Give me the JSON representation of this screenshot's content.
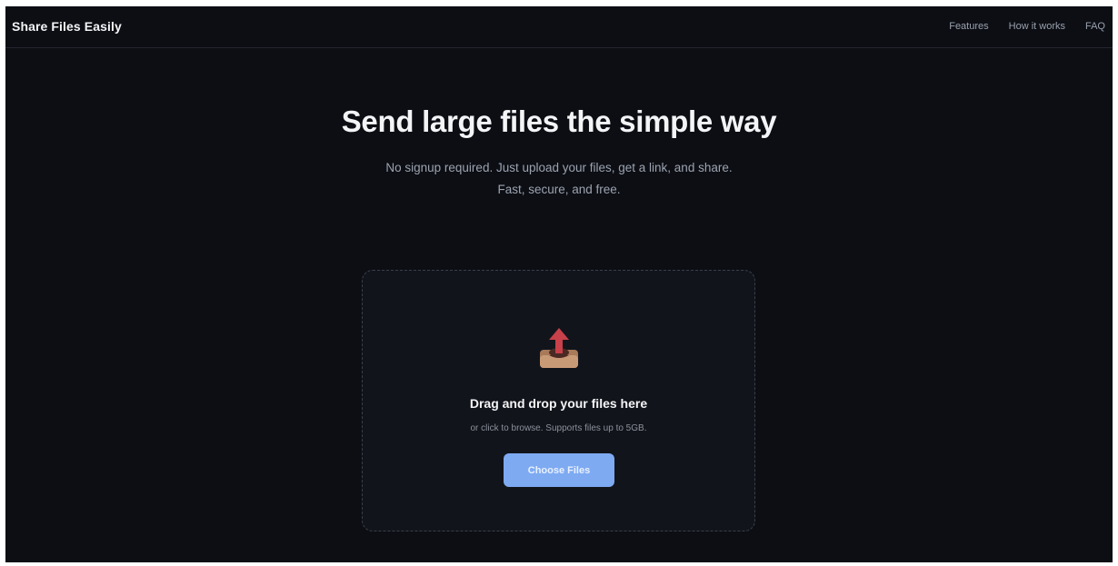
{
  "header": {
    "brand": "Share Files Easily",
    "nav": [
      "Features",
      "How it works",
      "FAQ"
    ]
  },
  "hero": {
    "title": "Send large files the simple way",
    "subtitle": "No signup required. Just upload your files, get a link, and share. Fast, secure, and free."
  },
  "dropzone": {
    "icon": "inbox-tray-upload-icon",
    "title": "Drag and drop your files here",
    "subtitle": "or click to browse. Supports files up to 5GB.",
    "button_label": "Choose Files"
  },
  "colors": {
    "background": "#0c0e14",
    "panel": "#12141b",
    "accent_button": "#7eaaf2",
    "icon_arrow": "#c7404a",
    "icon_tray": "#c99a76"
  }
}
